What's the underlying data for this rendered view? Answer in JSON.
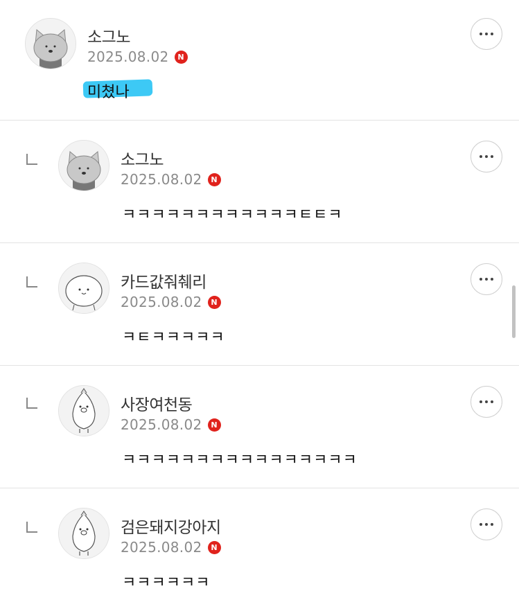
{
  "comments": [
    {
      "nickname": "소그노",
      "date": "2025.08.02",
      "badge": "N",
      "text": "미쳤나",
      "avatar": "cat-avatar-icon",
      "is_reply": false
    },
    {
      "nickname": "소그노",
      "date": "2025.08.02",
      "badge": "N",
      "text": "ㅋㅋㅋㅋㅋㅋㅋㅋㅋㅋㅋㅋㅌㅌㅋ",
      "avatar": "cat-avatar-icon",
      "is_reply": true
    },
    {
      "nickname": "카드값줘췌리",
      "date": "2025.08.02",
      "badge": "N",
      "text": "ㅋㅌㅋㅋㅋㅋㅋ",
      "avatar": "blob-avatar-icon",
      "is_reply": true
    },
    {
      "nickname": "사장여천동",
      "date": "2025.08.02",
      "badge": "N",
      "text": "ㅋㅋㅋㅋㅋㅋㅋㅋㅋㅋㅋㅋㅋㅋㅋㅋ",
      "avatar": "penguin-avatar-icon",
      "is_reply": true
    },
    {
      "nickname": "검은돼지강아지",
      "date": "2025.08.02",
      "badge": "N",
      "text": "ㅋㅋㅋㅋㅋㅋ",
      "avatar": "penguin-avatar-icon",
      "is_reply": true
    }
  ],
  "colors": {
    "highlight": "#33c6f4",
    "badge": "#e0221c",
    "date": "#8a8a8a"
  }
}
